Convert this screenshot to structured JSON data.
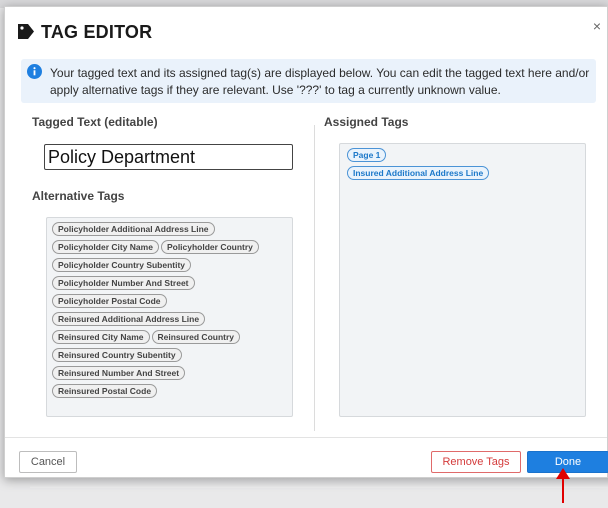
{
  "dialog": {
    "title": "TAG EDITOR",
    "close_label": "×"
  },
  "info": {
    "text": "Your tagged text and its assigned tag(s) are displayed below. You can edit the tagged text here and/or apply alternative tags if they are relevant. Use '???' to tag a currently unknown value."
  },
  "tagged_text": {
    "label": "Tagged Text (editable)",
    "value": "Policy Department"
  },
  "alternative_tags": {
    "label": "Alternative Tags",
    "rows": [
      [
        "Policyholder Additional Address Line"
      ],
      [
        "Policyholder City Name",
        "Policyholder Country"
      ],
      [
        "Policyholder Country Subentity"
      ],
      [
        "Policyholder Number And Street"
      ],
      [
        "Policyholder Postal Code"
      ],
      [
        "Reinsured Additional Address Line"
      ],
      [
        "Reinsured City Name",
        "Reinsured Country"
      ],
      [
        "Reinsured Country Subentity"
      ],
      [
        "Reinsured Number And Street"
      ],
      [
        "Reinsured Postal Code"
      ]
    ]
  },
  "assigned_tags": {
    "label": "Assigned Tags",
    "items": [
      "Page 1",
      "Insured Additional Address Line"
    ]
  },
  "footer": {
    "cancel_label": "Cancel",
    "remove_label": "Remove Tags",
    "done_label": "Done"
  },
  "colors": {
    "accent": "#1e7fe0",
    "danger": "#d43b3b",
    "annotation_arrow": "#e00000",
    "info_bg": "#eaf2fb"
  },
  "icons": [
    "tag-icon",
    "info-icon",
    "close-icon"
  ]
}
